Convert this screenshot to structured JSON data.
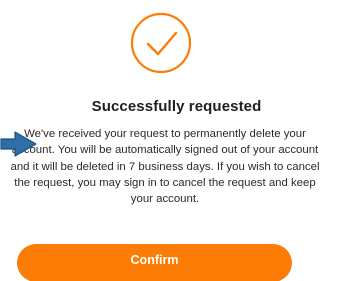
{
  "dialog": {
    "title": "Successfully requested",
    "message": "We've received your request to permanently delete your\naccount. You will be automatically signed out of your account\nand it will be deleted in 7 business days. If you wish to cancel\nthe request, you may sign in to cancel the request and keep\nyour account.",
    "confirm_label": "Confirm"
  },
  "icons": {
    "success": "check-circle-icon",
    "cursor": "arrow-cursor-icon"
  },
  "colors": {
    "accent": "#FC7C05",
    "title_text": "#1F1F1F",
    "body_text": "#2A2A2A",
    "cursor_fill": "#2F6FA8"
  }
}
